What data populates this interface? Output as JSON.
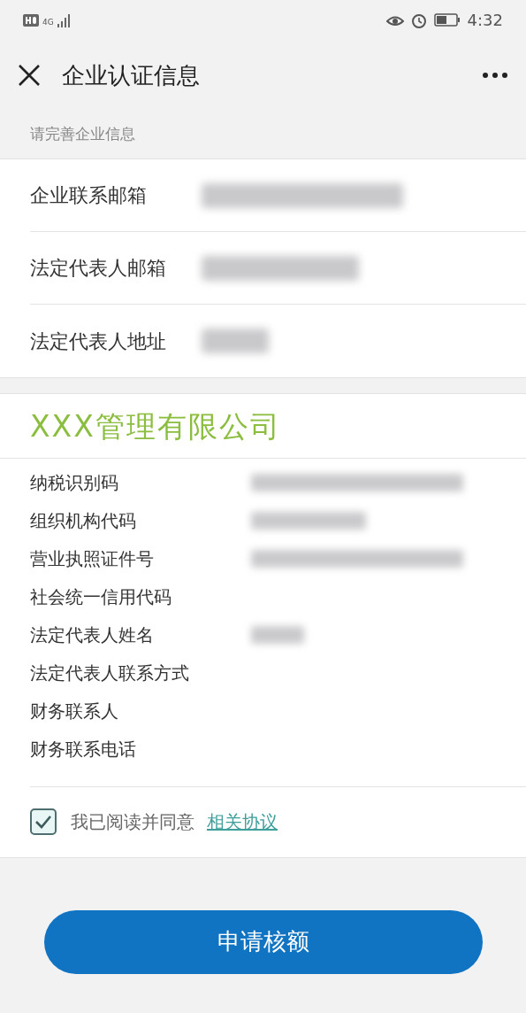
{
  "status_bar": {
    "network": "4G",
    "time": "4:32"
  },
  "header": {
    "title": "企业认证信息"
  },
  "section_hint": "请完善企业信息",
  "contact_rows": [
    {
      "label": "企业联系邮箱",
      "value_hidden": true
    },
    {
      "label": "法定代表人邮箱",
      "value_hidden": true
    },
    {
      "label": "法定代表人地址",
      "value_hidden": true
    }
  ],
  "company": {
    "name": "XXX管理有限公司",
    "fields": [
      {
        "label": "纳税识别码",
        "value_hidden": true
      },
      {
        "label": "组织机构代码",
        "value_hidden": true
      },
      {
        "label": "营业执照证件号",
        "value_hidden": true
      },
      {
        "label": "社会统一信用代码",
        "value_hidden": false
      },
      {
        "label": "法定代表人姓名",
        "value_hidden": true
      },
      {
        "label": "法定代表人联系方式",
        "value_hidden": false
      },
      {
        "label": "财务联系人",
        "value_hidden": false
      },
      {
        "label": "财务联系电话",
        "value_hidden": false
      }
    ]
  },
  "agreement": {
    "checked": true,
    "text": "我已阅读并同意",
    "link": "相关协议"
  },
  "submit_button": "申请核额"
}
